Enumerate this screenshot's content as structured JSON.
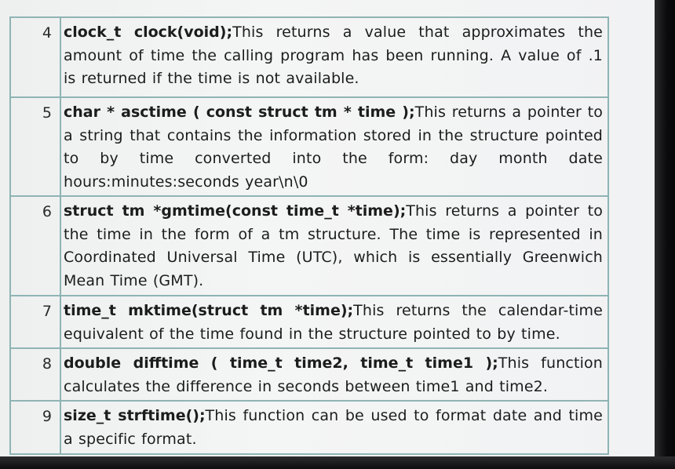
{
  "rows": [
    {
      "number": "4",
      "signature": "clock_t clock(void);",
      "description": "This returns a value that approximates the amount of time the calling program has been running. A value of .1 is returned if the time is not available."
    },
    {
      "number": "5",
      "signature": "char * asctime ( const struct tm * time );",
      "description": "This returns a pointer to a string that contains the information stored in the structure pointed to by time converted into the form: day month date hours:minutes:seconds year\\n\\0"
    },
    {
      "number": "6",
      "signature": "struct tm *gmtime(const time_t *time);",
      "description": "This returns a pointer to the time in the form of a tm structure. The time is represented in Coordinated Universal Time (UTC), which is essentially Greenwich Mean Time (GMT)."
    },
    {
      "number": "7",
      "signature": "time_t mktime(struct tm *time);",
      "description": "This returns the calendar-time equivalent of the time found in the structure pointed to by time."
    },
    {
      "number": "8",
      "signature": "double difftime ( time_t time2, time_t time1 );",
      "description": "This function calculates the difference in seconds between time1 and time2."
    },
    {
      "number": "9",
      "signature": "size_t strftime();",
      "description": "This function can be used to format date and time a specific format."
    }
  ]
}
